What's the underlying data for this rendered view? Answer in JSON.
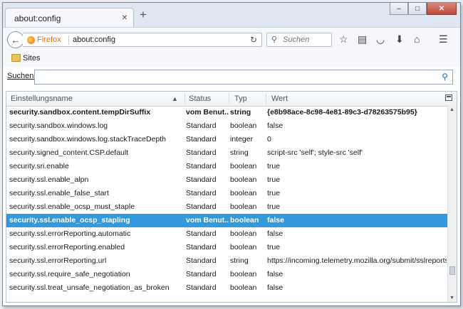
{
  "browser": {
    "tab_title": "about:config",
    "tab_close_icon": "close-icon",
    "new_tab_label": "+",
    "window_buttons": [
      "minimize-icon",
      "maximize-icon",
      "close-icon"
    ],
    "identity_label": "Firefox",
    "url": "about:config",
    "search_placeholder": "Suchen",
    "bookmark_folder": "Sites"
  },
  "filter": {
    "label": "Suchen:",
    "value": "",
    "icon": "search-icon"
  },
  "table": {
    "columns": [
      "Einstellungsname",
      "Status",
      "Typ",
      "Wert"
    ],
    "sort_column": "Einstellungsname",
    "sort_direction": "ascending",
    "rows": [
      {
        "name": "security.sandbox.content.tempDirSuffix",
        "status": "vom Benut...",
        "type": "string",
        "value": "{e8b98ace-8c98-4e81-89c3-d78263575b95}",
        "modified": true,
        "selected": false
      },
      {
        "name": "security.sandbox.windows.log",
        "status": "Standard",
        "type": "boolean",
        "value": "false",
        "modified": false,
        "selected": false
      },
      {
        "name": "security.sandbox.windows.log.stackTraceDepth",
        "status": "Standard",
        "type": "integer",
        "value": "0",
        "modified": false,
        "selected": false
      },
      {
        "name": "security.signed_content.CSP.default",
        "status": "Standard",
        "type": "string",
        "value": "script-src 'self'; style-src 'self'",
        "modified": false,
        "selected": false
      },
      {
        "name": "security.sri.enable",
        "status": "Standard",
        "type": "boolean",
        "value": "true",
        "modified": false,
        "selected": false
      },
      {
        "name": "security.ssl.enable_alpn",
        "status": "Standard",
        "type": "boolean",
        "value": "true",
        "modified": false,
        "selected": false
      },
      {
        "name": "security.ssl.enable_false_start",
        "status": "Standard",
        "type": "boolean",
        "value": "true",
        "modified": false,
        "selected": false
      },
      {
        "name": "security.ssl.enable_ocsp_must_staple",
        "status": "Standard",
        "type": "boolean",
        "value": "true",
        "modified": false,
        "selected": false
      },
      {
        "name": "security.ssl.enable_ocsp_stapling",
        "status": "vom Benut...",
        "type": "boolean",
        "value": "false",
        "modified": true,
        "selected": true
      },
      {
        "name": "security.ssl.errorReporting.automatic",
        "status": "Standard",
        "type": "boolean",
        "value": "false",
        "modified": false,
        "selected": false
      },
      {
        "name": "security.ssl.errorReporting.enabled",
        "status": "Standard",
        "type": "boolean",
        "value": "true",
        "modified": false,
        "selected": false
      },
      {
        "name": "security.ssl.errorReporting.url",
        "status": "Standard",
        "type": "string",
        "value": "https://incoming.telemetry.mozilla.org/submit/sslreports/",
        "modified": false,
        "selected": false
      },
      {
        "name": "security.ssl.require_safe_negotiation",
        "status": "Standard",
        "type": "boolean",
        "value": "false",
        "modified": false,
        "selected": false
      },
      {
        "name": "security.ssl.treat_unsafe_negotiation_as_broken",
        "status": "Standard",
        "type": "boolean",
        "value": "false",
        "modified": false,
        "selected": false
      }
    ]
  },
  "colors": {
    "selection": "#3399dd",
    "firefox_orange": "#e66a13"
  }
}
